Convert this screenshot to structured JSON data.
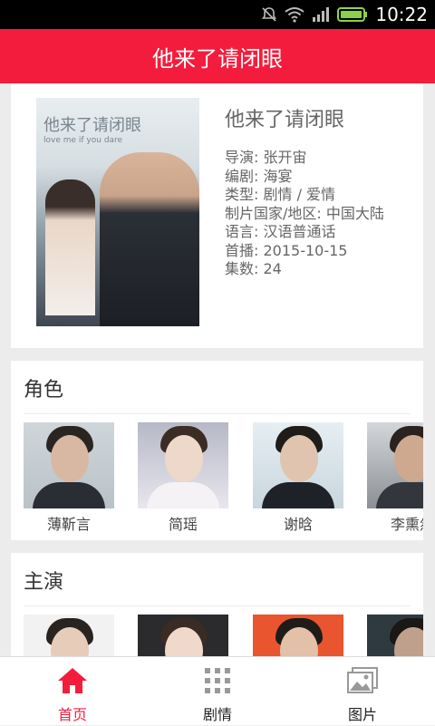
{
  "status_bar": {
    "time": "10:22"
  },
  "app_bar": {
    "title": "他来了请闭眼"
  },
  "show": {
    "poster_title": "他来了请闭眼",
    "poster_subtitle": "love me if you dare",
    "title": "他来了请闭眼",
    "director": "导演: 张开宙",
    "writer": "编剧: 海宴",
    "genre": "类型: 剧情 / 爱情",
    "country": "制片国家/地区: 中国大陆",
    "language": "语言: 汉语普通话",
    "premiere": "首播: 2015-10-15",
    "episodes": "集数: 24"
  },
  "roles": {
    "title": "角色",
    "items": [
      {
        "name": "薄靳言"
      },
      {
        "name": "简瑶"
      },
      {
        "name": "谢晗"
      },
      {
        "name": "李熏然"
      }
    ]
  },
  "cast": {
    "title": "主演"
  },
  "bottom_nav": {
    "items": [
      {
        "label": "首页",
        "icon": "home-icon",
        "active": true
      },
      {
        "label": "剧情",
        "icon": "grid-icon",
        "active": false
      },
      {
        "label": "图片",
        "icon": "gallery-icon",
        "active": false
      }
    ]
  },
  "colors": {
    "accent": "#f41c3c",
    "active_nav": "#f41c3c",
    "inactive_nav": "#999999"
  }
}
